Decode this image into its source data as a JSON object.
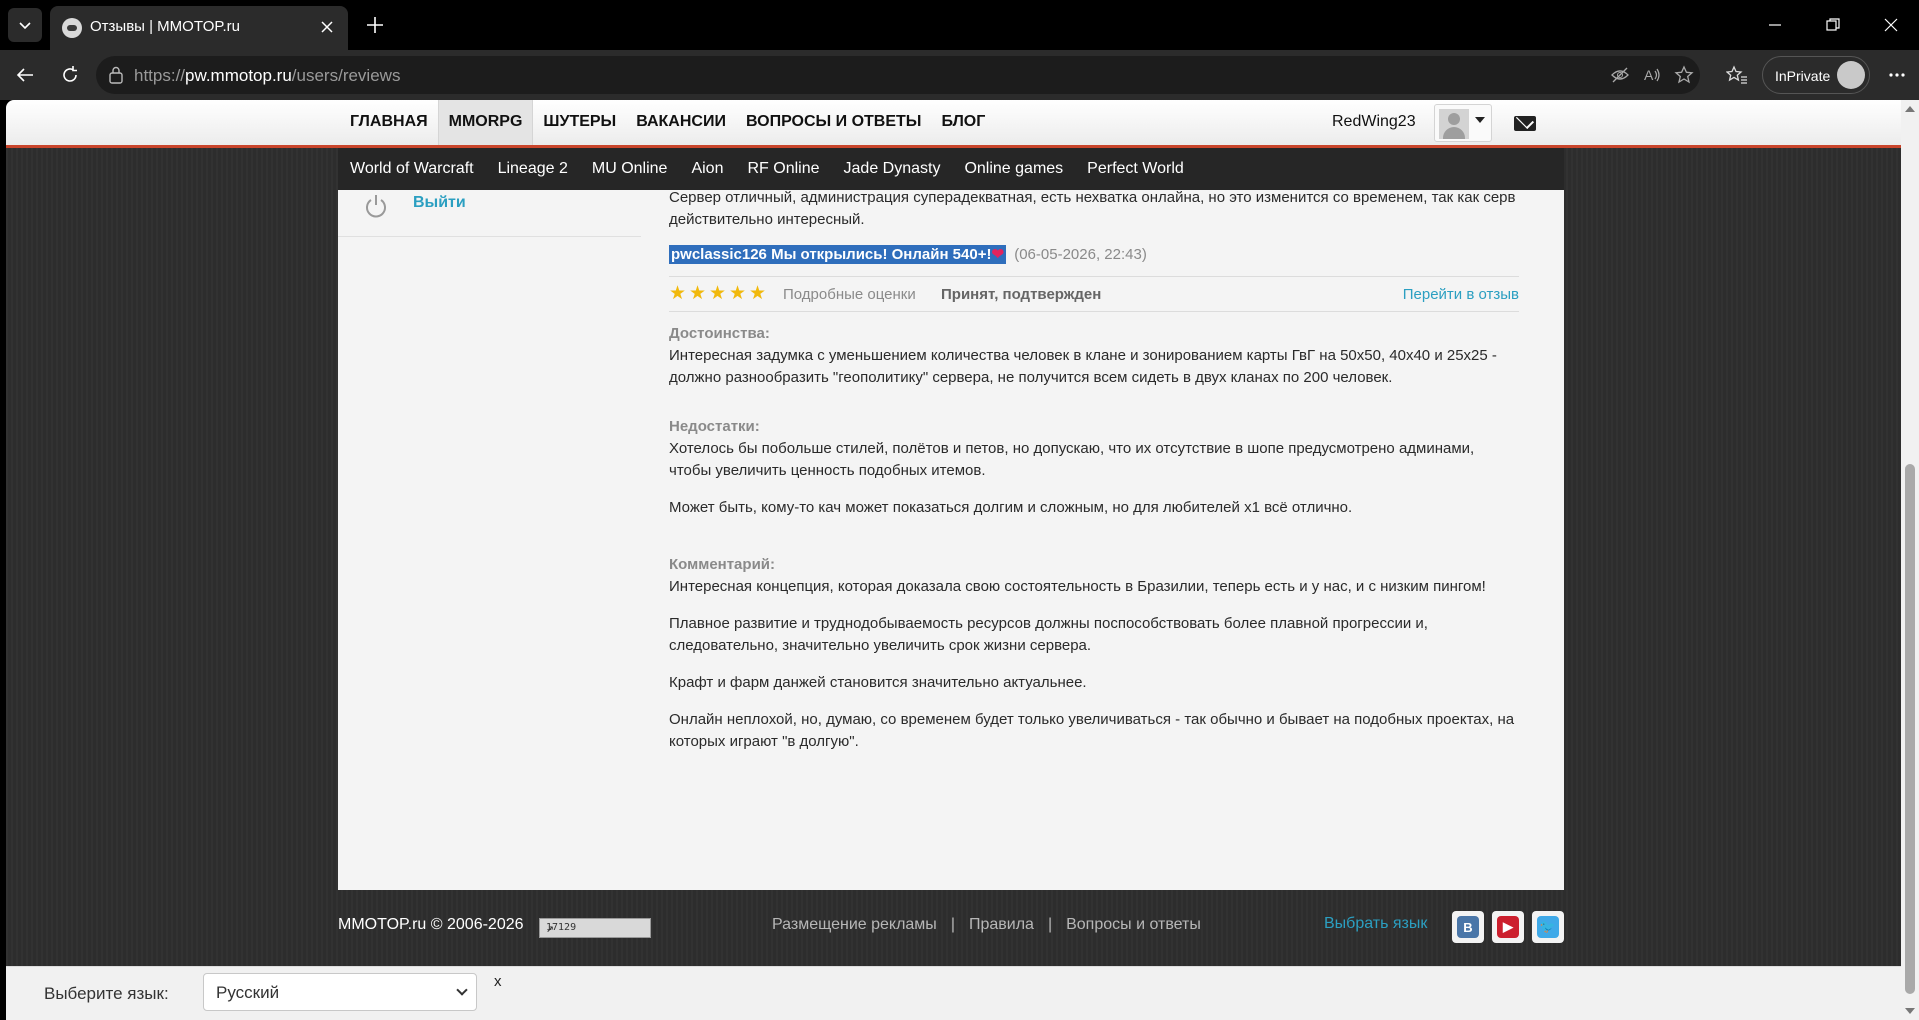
{
  "browser": {
    "tab_title": "Отзывы | MMOTOP.ru",
    "url_prefix": "https://",
    "url_host": "pw.mmotop.ru",
    "url_path": "/users/reviews",
    "inprivate_label": "InPrivate"
  },
  "site": {
    "main_nav": [
      "ГЛАВНАЯ",
      "MMORPG",
      "ШУТЕРЫ",
      "ВАКАНСИИ",
      "ВОПРОСЫ И ОТВЕТЫ",
      "БЛОГ"
    ],
    "active_main_nav": "MMORPG",
    "username": "RedWing23",
    "sub_nav": [
      "World of Warcraft",
      "Lineage 2",
      "MU Online",
      "Aion",
      "RF Online",
      "Jade Dynasty",
      "Online games",
      "Perfect World"
    ]
  },
  "sidebar": {
    "logout_label": "Выйти"
  },
  "review": {
    "intro": "Сервер отличный, администрация суперадекватная, есть нехватка онлайна, но это изменится со временем, так как серв действительно интересный.",
    "title": "pwclassic126 Мы открылись! Онлайн 540+!",
    "title_heart": "❤",
    "date": "(06-05-2026, 22:43)",
    "rating_stars": 5,
    "detailed_ratings_label": "Подробные оценки",
    "status": "Принят, подтвержден",
    "goto_label": "Перейти в отзыв",
    "pros_label": "Достоинства:",
    "pros_text": "Интересная задумка с уменьшением количества человек в клане и зонированием карты ГвГ на 50х50, 40х40 и 25х25 - должно разнообразить \"геополитику\" сервера, не получится всем сидеть в двух кланах по 200 человек.",
    "cons_label": "Недостатки:",
    "cons_text_1": "Хотелось бы побольше стилей, полётов и петов, но допускаю, что их отсутствие в шопе предусмотрено админами, чтобы увеличить ценность подобных итемов.",
    "cons_text_2": "Может быть, кому-то кач может показаться долгим и сложным, но для любителей х1 всё отлично.",
    "comment_label": "Комментарий:",
    "comment_text_1": "Интересная концепция, которая доказала свою состоятельность в Бразилии, теперь есть и у нас, и с низким пингом!",
    "comment_text_2": "Плавное развитие и труднодобываемость ресурсов должны поспособствовать более плавной прогрессии и, следовательно, значительно увеличить срок жизни сервера.",
    "comment_text_3": "Крафт и фарм данжей становится значительно актуальнее.",
    "comment_text_4": "Онлайн неплохой, но, думаю, со временем будет только увеличиваться - так обычно и бывает на подобных проектах, на которых играют \"в долгую\"."
  },
  "footer": {
    "copyright": "MMOTOP.ru © 2006-2026",
    "counter": "17129",
    "links": [
      "Размещение рекламы",
      "Правила",
      "Вопросы и ответы"
    ],
    "separator": "|",
    "choose_language": "Выбрать язык",
    "social": [
      {
        "name": "vk-icon",
        "glyph": "В",
        "color": "#4a76a8"
      },
      {
        "name": "youtube-icon",
        "glyph": "▶",
        "color": "#cc1f2d"
      },
      {
        "name": "twitter-icon",
        "glyph": "🐦",
        "color": "#3fa9e8"
      }
    ]
  },
  "langbar": {
    "label": "Выберите язык:",
    "selected": "Русский",
    "close": "x"
  },
  "colors": {
    "accent_link": "#2b9fc1",
    "header_stripe": "#c9452b",
    "title_highlight": "#2f6ebc",
    "star": "#f1b90c"
  }
}
